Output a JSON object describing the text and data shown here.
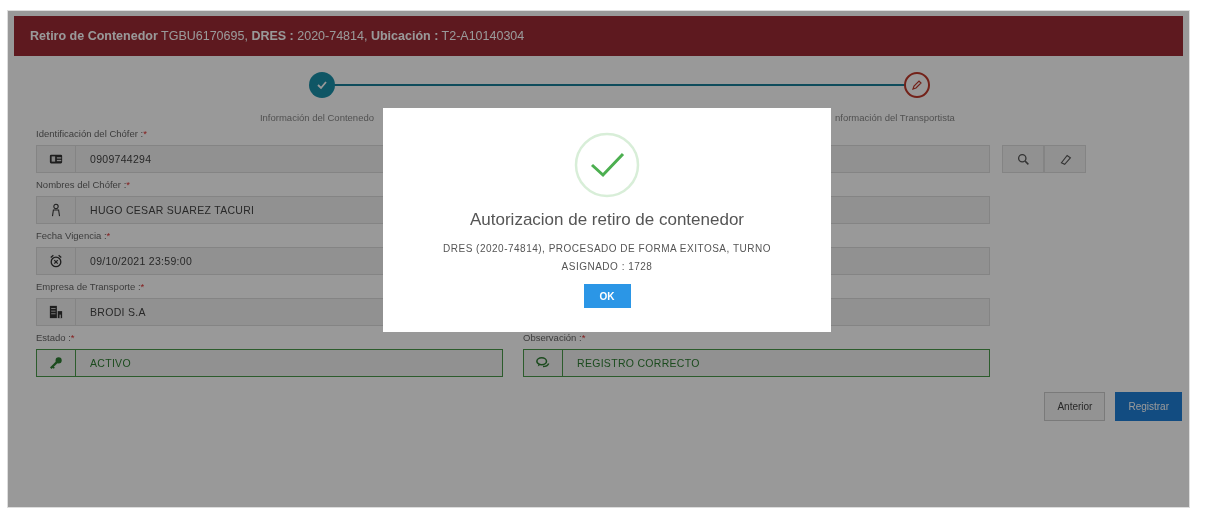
{
  "header": {
    "title": "**Retiro de Contenedor** TGBU6170695, **DRES :** 2020-74814, **Ubicación :** T2-A10140304"
  },
  "steps": [
    {
      "label": "Información del Contenedo",
      "completed": true
    },
    {
      "label": "nformación del Transportista",
      "completed": false
    }
  ],
  "fields": [
    {
      "label": "Identificación del Chófer :",
      "required": "*",
      "value": "0909744294",
      "valid": false
    },
    {
      "label": "Nombres del Chófer :",
      "required": "*",
      "value": "HUGO CESAR SUAREZ TACURI",
      "valid": false
    },
    {
      "label": "Fecha Vigencia :",
      "required": "*",
      "value": "09/10/2021 23:59:00",
      "valid": false
    },
    {
      "label": "Empresa de Transporte :",
      "required": "*",
      "value": "BRODI S.A",
      "valid": false
    },
    {
      "label": "Estado :",
      "required": "*",
      "value": "ACTIVO",
      "valid": true
    },
    {
      "label": "Observación :",
      "required": "*",
      "value": "REGISTRO CORRECTO",
      "valid": true
    }
  ],
  "buttons": [
    {
      "label": "Anterior",
      "primary": false
    },
    {
      "label": "Registrar",
      "primary": true
    }
  ],
  "dialog": {
    "title": "Autorizacion de retiro de contenedor",
    "message": "DRES (2020-74814), PROCESADO DE FORMA EXITOSA, TURNO ASIGNADO : 1728",
    "button": "OK"
  }
}
